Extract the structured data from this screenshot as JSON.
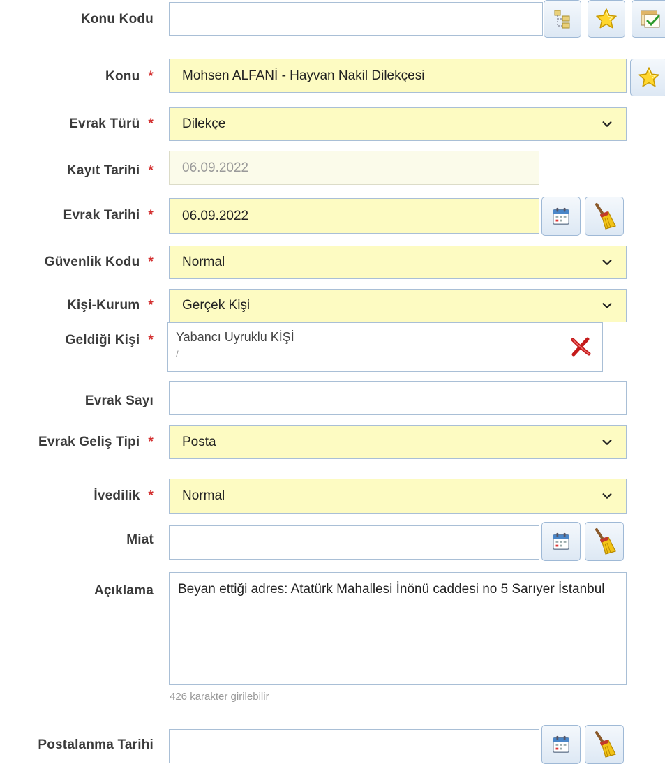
{
  "form": {
    "konu_kodu": {
      "label": "Konu Kodu",
      "value": ""
    },
    "konu": {
      "label": "Konu",
      "required": "*",
      "value": "Mohsen ALFANİ - Hayvan Nakil Dilekçesi"
    },
    "evrak_turu": {
      "label": "Evrak Türü",
      "required": "*",
      "value": "Dilekçe"
    },
    "kayit_tarihi": {
      "label": "Kayıt Tarihi",
      "required": "*",
      "value": "06.09.2022"
    },
    "evrak_tarihi": {
      "label": "Evrak Tarihi",
      "required": "*",
      "value": "06.09.2022"
    },
    "guvenlik_kodu": {
      "label": "Güvenlik Kodu",
      "required": "*",
      "value": "Normal"
    },
    "kisi_kurum": {
      "label": "Kişi-Kurum",
      "required": "*",
      "value": "Gerçek Kişi"
    },
    "geldigi_kisi": {
      "label": "Geldiği Kişi",
      "required": "*",
      "name": "Yabancı Uyruklu KİŞİ",
      "sub": "/"
    },
    "evrak_sayi": {
      "label": "Evrak Sayı",
      "value": ""
    },
    "evrak_gelis_tipi": {
      "label": "Evrak Geliş Tipi",
      "required": "*",
      "value": "Posta"
    },
    "ivedilik": {
      "label": "İvedilik",
      "required": "*",
      "value": "Normal"
    },
    "miat": {
      "label": "Miat",
      "value": ""
    },
    "aciklama": {
      "label": "Açıklama",
      "value": "Beyan ettiği adres: Atatürk Mahallesi İnönü caddesi no 5 Sarıyer İstanbul",
      "hint": "426 karakter girilebilir"
    },
    "postalanma_tarihi": {
      "label": "Postalanma Tarihi",
      "value": ""
    }
  },
  "icons": [
    "tree-select-icon",
    "favorite-star-icon",
    "checklist-icon",
    "calendar-icon",
    "broom-clear-icon",
    "remove-x-icon",
    "chevron-down-icon"
  ],
  "colors": {
    "required": "#d32f2f",
    "field_yellow": "#fdfbc2",
    "border": "#a9bfd6"
  }
}
